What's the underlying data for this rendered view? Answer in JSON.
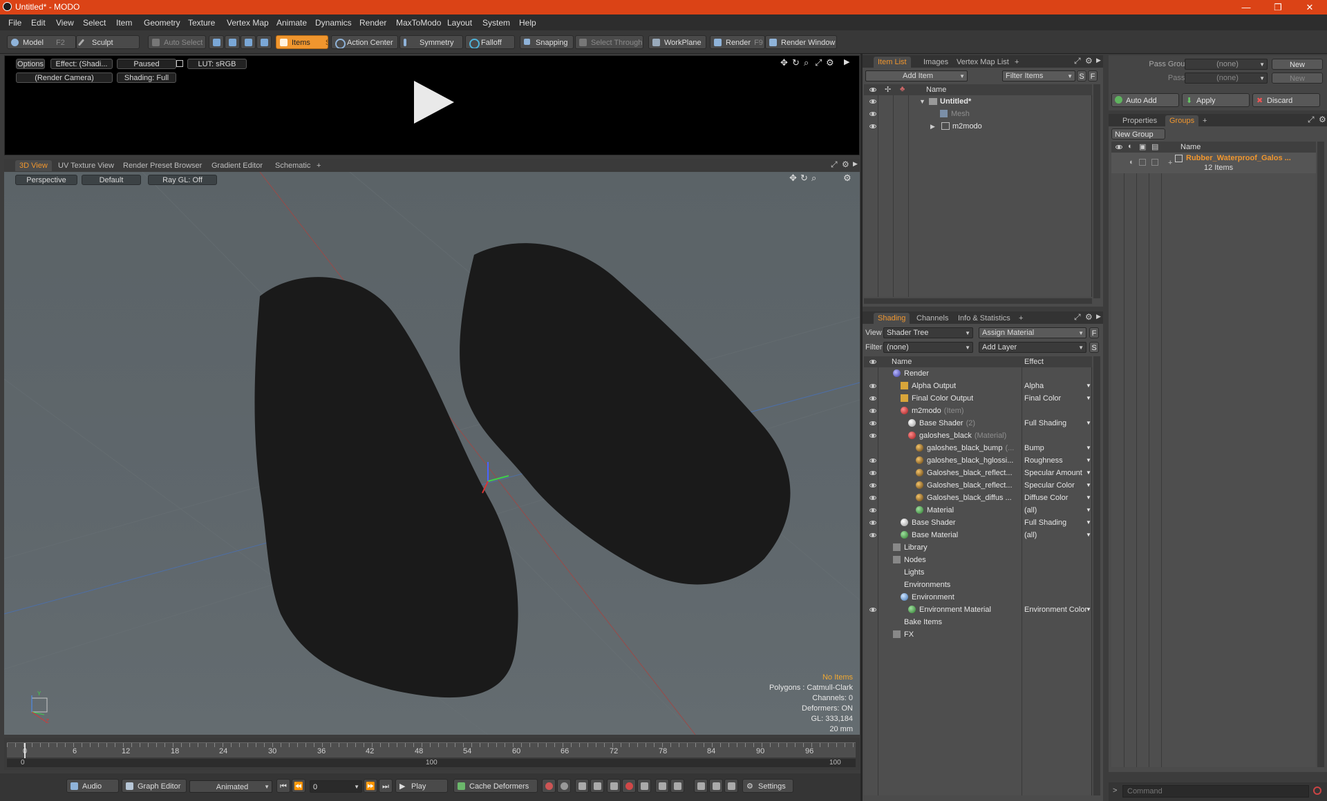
{
  "window": {
    "title": "Untitled* - MODO",
    "minimize": "—",
    "maximize": "❐",
    "close": "✕"
  },
  "menu": [
    "File",
    "Edit",
    "View",
    "Select",
    "Item",
    "Geometry",
    "Texture",
    "Vertex Map",
    "Animate",
    "Dynamics",
    "Render",
    "MaxToModo",
    "Layout",
    "System",
    "Help"
  ],
  "toolbar": {
    "model": "Model",
    "model_key": "F2",
    "sculpt": "Sculpt",
    "auto_select": "Auto Select",
    "items": "Items",
    "items_key": "S",
    "action_center": "Action Center",
    "symmetry": "Symmetry",
    "falloff": "Falloff",
    "snapping": "Snapping",
    "select_through": "Select Through",
    "workplane": "WorkPlane",
    "render": "Render",
    "render_key": "F9",
    "render_window": "Render Window"
  },
  "preview": {
    "options": "Options",
    "effect": "Effect: (Shadi...",
    "paused": "Paused",
    "lut": "LUT: sRGB",
    "camera": "(Render Camera)",
    "shading": "Shading: Full",
    "play_icon": "play-icon"
  },
  "viewport": {
    "tabs": [
      "3D View",
      "UV Texture View",
      "Render Preset Browser",
      "Gradient Editor",
      "Schematic"
    ],
    "add_tab": "+",
    "perspective": "Perspective",
    "default": "Default",
    "raygl": "Ray GL: Off",
    "info": {
      "no_items": "No Items",
      "polygons": "Polygons : Catmull-Clark",
      "channels": "Channels: 0",
      "deformers": "Deformers: ON",
      "gl": "GL: 333,184",
      "scale": "20 mm"
    },
    "axis_y": "Y",
    "axis_z": "Z"
  },
  "timeline": {
    "ticks": [
      "0",
      "6",
      "12",
      "18",
      "24",
      "30",
      "36",
      "42",
      "48",
      "54",
      "60",
      "66",
      "72",
      "78",
      "84",
      "90",
      "96"
    ],
    "range_start": "0",
    "range_mid": "100",
    "range_end": "100"
  },
  "bottombar": {
    "audio": "Audio",
    "graph_editor": "Graph Editor",
    "animated": "Animated",
    "frame": "0",
    "play": "Play",
    "cache_deformers": "Cache Deformers",
    "settings": "Settings"
  },
  "item_list": {
    "tabs": [
      "Item List",
      "Images",
      "Vertex Map List"
    ],
    "add_tab": "+",
    "add_item": "Add Item",
    "filter_items": "Filter Items",
    "s_btn": "S",
    "f_btn": "F",
    "col_name": "Name",
    "rows": [
      {
        "label": "Untitled*",
        "indent": 0
      },
      {
        "label": "Mesh",
        "indent": 1
      },
      {
        "label": "m2modo",
        "indent": 1
      }
    ]
  },
  "shading": {
    "tabs": [
      "Shading",
      "Channels",
      "Info & Statistics"
    ],
    "add_tab": "+",
    "view_label": "View",
    "view_value": "Shader Tree",
    "assign_material": "Assign Material",
    "f_btn": "F",
    "filter_label": "Filter",
    "filter_value": "(none)",
    "add_layer": "Add Layer",
    "s_btn": "S",
    "col_name": "Name",
    "col_effect": "Effect",
    "rows": [
      {
        "name": "Render",
        "suffix": "",
        "effect": "",
        "indent": 0,
        "eye": false,
        "icon": "render-sphere-icon"
      },
      {
        "name": "Alpha Output",
        "suffix": "",
        "effect": "Alpha",
        "indent": 1,
        "eye": true,
        "icon": "output-icon"
      },
      {
        "name": "Final Color Output",
        "suffix": "",
        "effect": "Final Color",
        "indent": 1,
        "eye": true,
        "icon": "output-icon"
      },
      {
        "name": "m2modo",
        "suffix": "(Item)",
        "effect": "",
        "indent": 1,
        "eye": true,
        "icon": "mask-icon"
      },
      {
        "name": "Base Shader",
        "suffix": "(2)",
        "effect": "Full Shading",
        "indent": 2,
        "eye": true,
        "icon": "shader-icon"
      },
      {
        "name": "galoshes_black",
        "suffix": "(Material)",
        "effect": "",
        "indent": 2,
        "eye": true,
        "icon": "mask-icon"
      },
      {
        "name": "galoshes_black_bump",
        "suffix": "(...",
        "effect": "Bump",
        "indent": 3,
        "eye": false,
        "icon": "texture-icon"
      },
      {
        "name": "galoshes_black_hglossi...",
        "suffix": "",
        "effect": "Roughness",
        "indent": 3,
        "eye": true,
        "icon": "texture-icon"
      },
      {
        "name": "Galoshes_black_reflect...",
        "suffix": "",
        "effect": "Specular Amount",
        "indent": 3,
        "eye": true,
        "icon": "texture-icon"
      },
      {
        "name": "Galoshes_black_reflect...",
        "suffix": "",
        "effect": "Specular Color",
        "indent": 3,
        "eye": true,
        "icon": "texture-icon"
      },
      {
        "name": "Galoshes_black_diffus ...",
        "suffix": "",
        "effect": "Diffuse Color",
        "indent": 3,
        "eye": true,
        "icon": "texture-icon"
      },
      {
        "name": "Material",
        "suffix": "",
        "effect": "(all)",
        "indent": 3,
        "eye": true,
        "icon": "material-icon"
      },
      {
        "name": "Base Shader",
        "suffix": "",
        "effect": "Full Shading",
        "indent": 1,
        "eye": true,
        "icon": "shader-icon"
      },
      {
        "name": "Base Material",
        "suffix": "",
        "effect": "(all)",
        "indent": 1,
        "eye": true,
        "icon": "material-icon"
      },
      {
        "name": "Library",
        "suffix": "",
        "effect": "",
        "indent": 0,
        "eye": false,
        "icon": "folder-icon"
      },
      {
        "name": "Nodes",
        "suffix": "",
        "effect": "",
        "indent": 0,
        "eye": false,
        "icon": "folder-icon"
      },
      {
        "name": "Lights",
        "suffix": "",
        "effect": "",
        "indent": 0,
        "eye": false,
        "icon": ""
      },
      {
        "name": "Environments",
        "suffix": "",
        "effect": "",
        "indent": 0,
        "eye": false,
        "icon": ""
      },
      {
        "name": "Environment",
        "suffix": "",
        "effect": "",
        "indent": 1,
        "eye": false,
        "icon": "environment-icon"
      },
      {
        "name": "Environment Material",
        "suffix": "",
        "effect": "Environment Color",
        "indent": 2,
        "eye": true,
        "icon": "material-icon"
      },
      {
        "name": "Bake Items",
        "suffix": "",
        "effect": "",
        "indent": 0,
        "eye": false,
        "icon": ""
      },
      {
        "name": "FX",
        "suffix": "",
        "effect": "",
        "indent": 0,
        "eye": false,
        "icon": "fx-icon"
      }
    ]
  },
  "groups_panel": {
    "pass_groups_label": "Pass Groups",
    "pass_groups_value": "(none)",
    "new": "New",
    "passes_label": "Passes",
    "passes_value": "(none)",
    "new2": "New",
    "auto_add": "Auto Add",
    "apply": "Apply",
    "discard": "Discard",
    "tabs": [
      "Properties",
      "Groups"
    ],
    "add_tab": "+",
    "new_group": "New Group",
    "col_name": "Name",
    "group_name": "Rubber_Waterproof_Galos ...",
    "group_count": "12 Items",
    "command_placeholder": "Command",
    "command_prompt": ">"
  },
  "colors": {
    "accent": "#f0962e",
    "titlebar": "#db4316",
    "viewport": "#5f676c"
  }
}
